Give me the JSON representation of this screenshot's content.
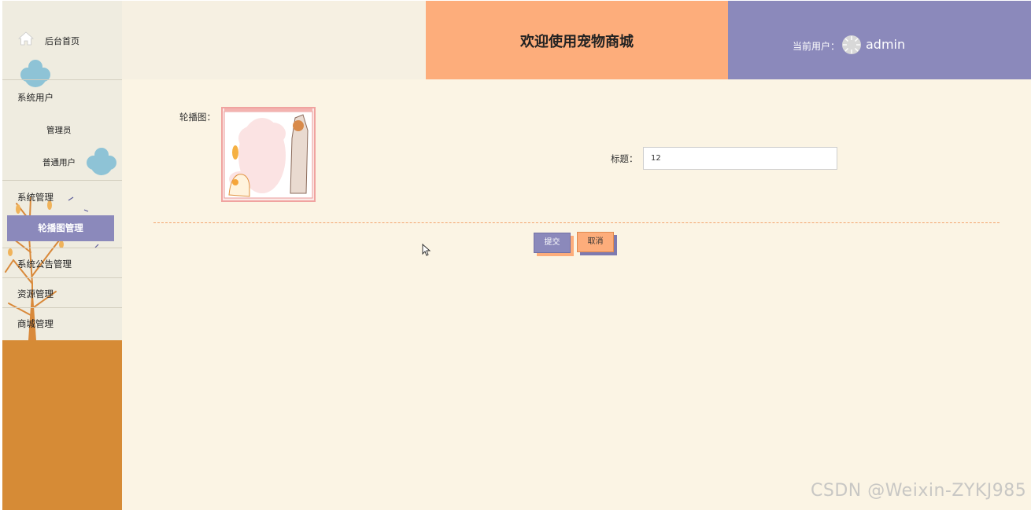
{
  "sidebar": {
    "home_label": "后台首页",
    "group_system_users": "系统用户",
    "sub_admin": "管理员",
    "sub_regular_user": "普通用户",
    "group_system_management": "系统管理",
    "active_carousel": "轮播图管理",
    "group_announcement": "系统公告管理",
    "group_resources": "资源管理",
    "group_mall": "商城管理"
  },
  "header": {
    "title": "欢迎使用宠物商城",
    "current_user_label": "当前用户：",
    "username": "admin"
  },
  "form": {
    "carousel_label": "轮播图：",
    "title_label": "标题：",
    "title_value": "12",
    "submit_label": "提交",
    "cancel_label": "取消"
  },
  "watermark": "CSDN @Weixin-ZYKJ985",
  "colors": {
    "accent_orange": "#fdad7b",
    "accent_purple": "#8b89bb",
    "sidebar_bottom": "#d68b36",
    "page_bg": "#fbf4e4"
  }
}
